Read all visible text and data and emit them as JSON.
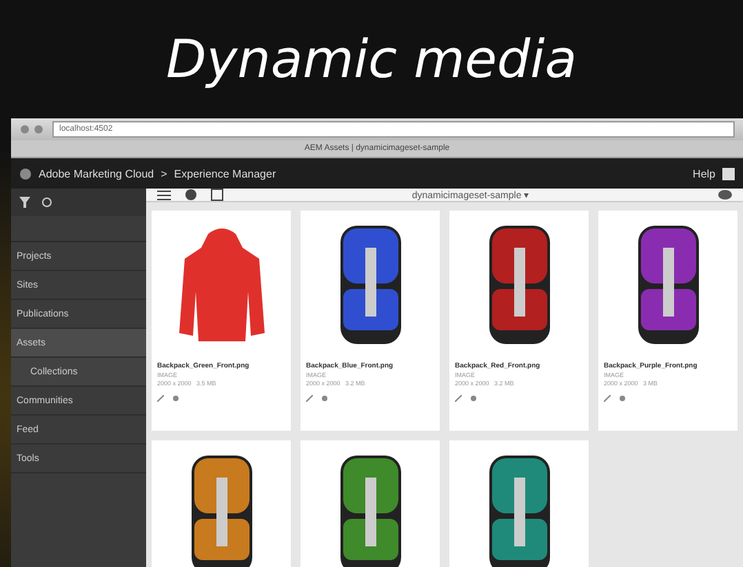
{
  "slide_title": "Dynamic media",
  "browser": {
    "address": "localhost:4502",
    "tab": "AEM Assets | dynamicimageset-sample"
  },
  "header": {
    "brand": "Adobe Marketing Cloud",
    "separator": ">",
    "product": "Experience Manager",
    "help": "Help"
  },
  "toolbar": {
    "folder": "dynamicimageset-sample ▾"
  },
  "sidebar": {
    "items": [
      {
        "label": "Projects",
        "selected": false
      },
      {
        "label": "Sites",
        "selected": false
      },
      {
        "label": "Publications",
        "selected": false
      },
      {
        "label": "Assets",
        "selected": true,
        "children": [
          {
            "label": "Collections"
          }
        ]
      },
      {
        "label": "Communities",
        "selected": false
      },
      {
        "label": "Feed",
        "selected": false
      },
      {
        "label": "Tools",
        "selected": false
      }
    ]
  },
  "cards": [
    {
      "kind": "jacket",
      "color": "#e0302c",
      "name": "Backpack_Green_Front.png",
      "type": "IMAGE",
      "meta": "2000 x 2000   3.5 MB"
    },
    {
      "kind": "backpack",
      "color": "#2f4fd0",
      "name": "Backpack_Blue_Front.png",
      "type": "IMAGE",
      "meta": "2000 x 2000   3.2 MB"
    },
    {
      "kind": "backpack",
      "color": "#b22020",
      "name": "Backpack_Red_Front.png",
      "type": "IMAGE",
      "meta": "2000 x 2000   3.2 MB"
    },
    {
      "kind": "backpack",
      "color": "#8a2cb0",
      "name": "Backpack_Purple_Front.png",
      "type": "IMAGE",
      "meta": "2000 x 2000   3 MB"
    },
    {
      "kind": "backpack",
      "color": "#c87a1e"
    },
    {
      "kind": "backpack",
      "color": "#3f8a2a"
    },
    {
      "kind": "backpack",
      "color": "#1f8a7a"
    }
  ]
}
